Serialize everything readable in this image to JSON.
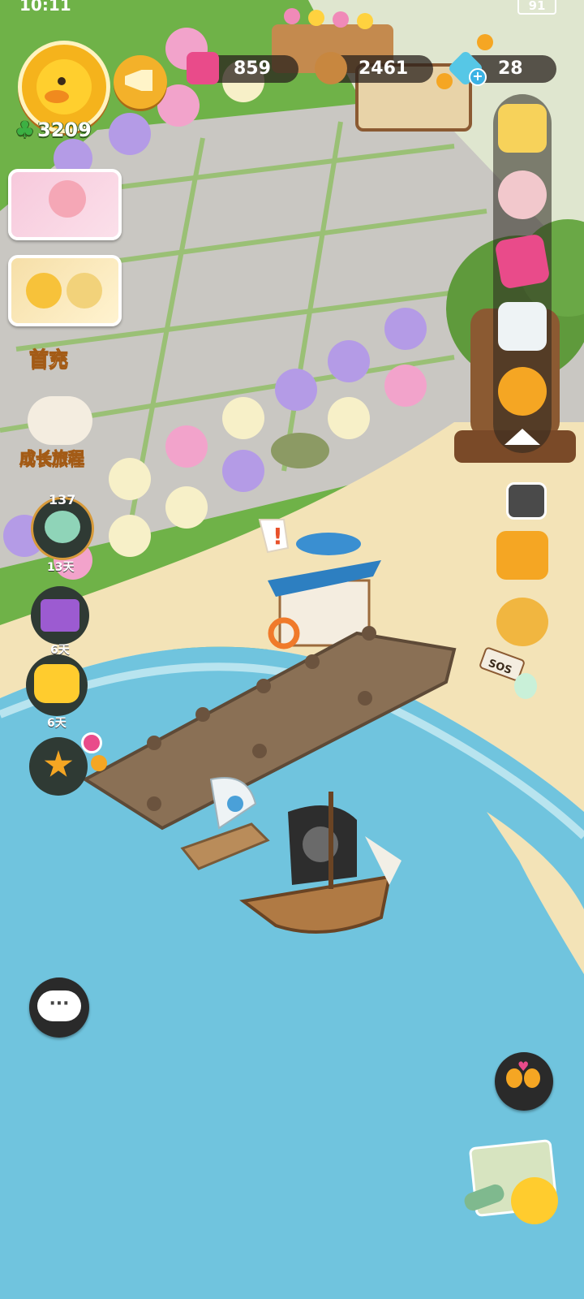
{
  "status_bar": {
    "time": "10:11",
    "battery": "91"
  },
  "resources": {
    "flour": {
      "value": "859",
      "icon": "pink-jar-icon"
    },
    "wood": {
      "value": "2461",
      "icon": "wood-log-icon"
    },
    "gems": {
      "value": "28",
      "icon": "diamond-icon"
    }
  },
  "player": {
    "clover_count": "3209",
    "avatar_icon": "duck-avatar-icon"
  },
  "left_menu": {
    "recharge_label": "首充",
    "growth_label": "成长旅程",
    "event_item_count": "137",
    "event_item_days": "13天",
    "gift_days": "6天",
    "ticket_days": "6天"
  },
  "map": {
    "sos_sign": "SOS"
  },
  "colors": {
    "sea": "#70c4de",
    "sand": "#f3e3b7",
    "grass": "#6fb248",
    "stone": "#c9c7c2",
    "accent_pink": "#e94b8a"
  }
}
